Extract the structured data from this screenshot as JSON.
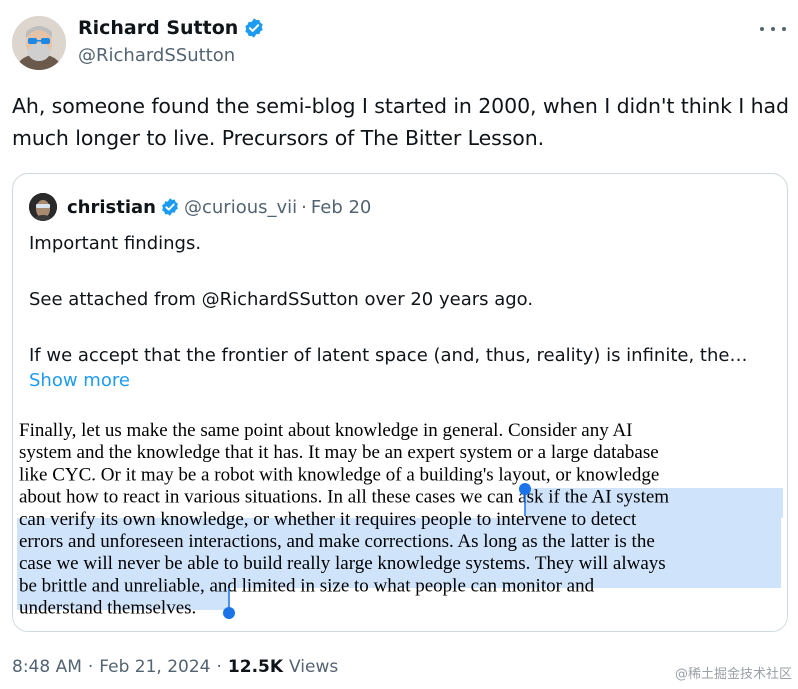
{
  "tweet": {
    "author": {
      "name": "Richard Sutton",
      "handle": "@RichardSSutton",
      "verified": true
    },
    "text": "Ah, someone found the semi-blog I started in 2000, when I didn't think I had much longer to live. Precursors of The Bitter Lesson.",
    "time": "8:48 AM",
    "date": "Feb 21, 2024",
    "views_count": "12.5K",
    "views_label": "Views",
    "separator": "·"
  },
  "quote": {
    "author": {
      "name": "christian",
      "handle": "@curious_vii",
      "date": "Feb 20",
      "verified": true
    },
    "text": "Important findings.\n\nSee attached from @RichardSSutton over 20 years ago.\n\nIf we accept that the frontier of latent space (and, thus, reality) is infinite, the…",
    "show_more": "Show more",
    "image": {
      "lines": [
        "Finally, let us make the same point about knowledge in general. Consider any AI",
        "system and the knowledge that it has. It may be an expert system or a large database",
        "like CYC. Or it may be a robot with knowledge of a building's layout, or knowledge",
        "about how to react in various situations. In all these cases we can ask if the AI system",
        "can verify its own knowledge, or whether it requires people to intervene to detect",
        "errors and unforeseen interactions, and make corrections. As long as the latter is the",
        "case we will never be able to build really large knowledge systems. They will always",
        "be brittle and unreliable, and limited in size to what people can monitor and",
        "understand themselves."
      ],
      "selection_color": "#cfe3fb",
      "handle_color": "#1a73e8"
    }
  },
  "colors": {
    "accent": "#1d9bf0",
    "secondary_text": "#536471",
    "border": "#cfd9de"
  },
  "icons": {
    "verified": "verified-badge-icon",
    "more": "more-options-icon"
  },
  "watermark": "@稀土掘金技术社区"
}
